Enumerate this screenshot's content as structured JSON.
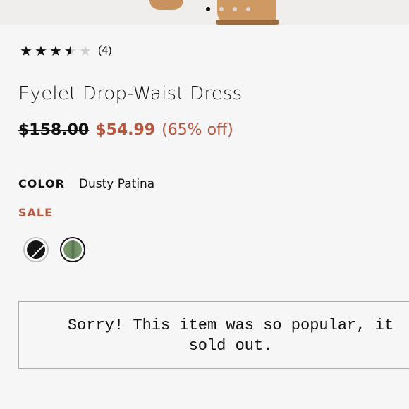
{
  "carousel": {
    "slide_count": 4,
    "active_index": 0
  },
  "rating": {
    "value": 3.5,
    "max": 5,
    "review_count_label": "(4)"
  },
  "product": {
    "title": "Eyelet Drop-Waist Dress"
  },
  "pricing": {
    "original_price": "$158.00",
    "sale_price": "$54.99",
    "discount_label": "(65% off)"
  },
  "color": {
    "label": "COLOR",
    "selected_value": "Dusty Patina",
    "sale_label": "SALE"
  },
  "swatches": [
    {
      "name": "black",
      "color": "#141414",
      "unavailable": true,
      "selected": false
    },
    {
      "name": "dusty-patina",
      "color": "#6e8d64",
      "unavailable": false,
      "selected": true
    }
  ],
  "notice": {
    "line1": "Sorry! This item was so popular, it",
    "line2": "sold out."
  },
  "colors": {
    "accent": "#b8553d",
    "text": "#111111",
    "background": "#f7f6f7"
  }
}
